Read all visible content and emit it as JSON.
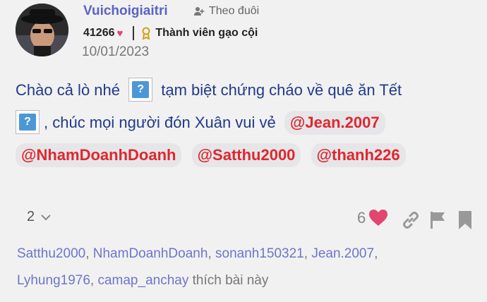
{
  "post": {
    "username": "Vuichoigiaitri",
    "follow_label": "Theo đuôi",
    "score": "41266",
    "rank": "Thành viên gạo cội",
    "date": "10/01/2023",
    "text_1": "Chào cả lò nhé",
    "text_2": "tạm biệt chứng cháo về quê ăn Tết",
    "text_3": ", chúc mọi người đón Xuân vui vẻ",
    "mentions": [
      "@Jean.2007",
      "@NhamDoanhDoanh",
      "@Satthu2000",
      "@thanh226"
    ],
    "emoji_glyph": "?"
  },
  "controls": {
    "replies_count": "2",
    "likes_count": "6"
  },
  "liked_by": {
    "names": [
      "Satthu2000",
      "NhamDoanhDoanh",
      "sonanh150321",
      "Jean.2007",
      "Lyhung1976",
      "camap_anchay"
    ],
    "suffix": "thích bài này"
  }
}
